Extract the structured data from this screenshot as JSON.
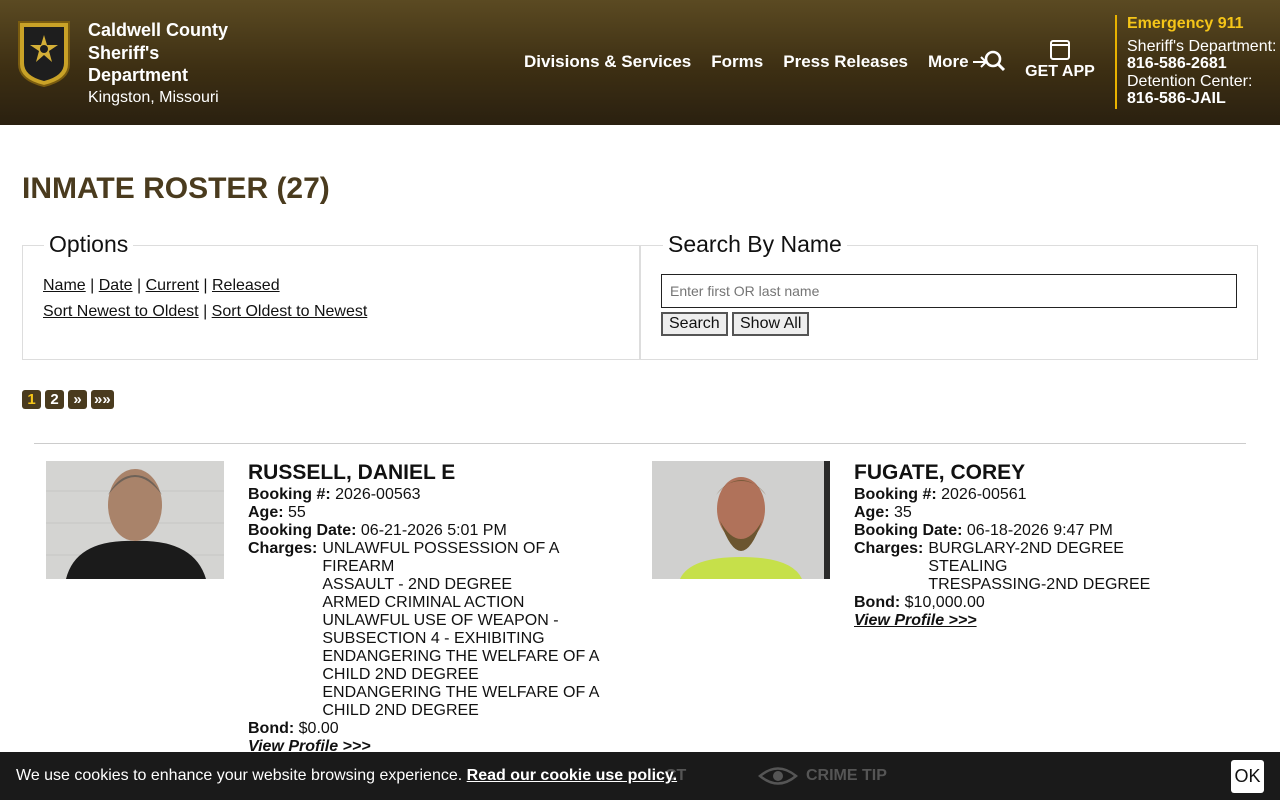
{
  "header": {
    "agency_name": "Caldwell County Sheriff's Department",
    "location": "Kingston, Missouri",
    "nav": [
      {
        "label": "Divisions & Services"
      },
      {
        "label": "Forms"
      },
      {
        "label": "Press Releases"
      },
      {
        "label": "More"
      }
    ],
    "get_app": "GET APP",
    "emergency": "Emergency 911",
    "sheriff_label": "Sheriff's Department:",
    "sheriff_phone": "816-586-2681",
    "detention_label": "Detention Center:",
    "detention_phone": "816-586-JAIL"
  },
  "page": {
    "title": "INMATE ROSTER (27)"
  },
  "options": {
    "legend": "Options",
    "links_row1": [
      "Name",
      "Date",
      "Current",
      "Released"
    ],
    "links_row2": [
      "Sort Newest to Oldest",
      "Sort Oldest to Newest"
    ]
  },
  "search": {
    "legend": "Search By Name",
    "placeholder": "Enter first OR last name",
    "search_button": "Search",
    "show_all_button": "Show All"
  },
  "pager": {
    "pages": [
      "1",
      "2"
    ],
    "next": "»",
    "last": "»»",
    "current": "1"
  },
  "labels": {
    "booking": "Booking #:",
    "age": "Age:",
    "booking_date": "Booking Date:",
    "charges": "Charges:",
    "bond": "Bond:",
    "view_profile": "View Profile >>>"
  },
  "inmates": [
    {
      "name": "RUSSELL, DANIEL E",
      "booking": "2026-00563",
      "age": "55",
      "booking_date": "06-21-2026 5:01 PM",
      "charges": [
        "UNLAWFUL POSSESSION OF A FIREARM",
        "ASSAULT - 2ND DEGREE",
        "ARMED CRIMINAL ACTION",
        "UNLAWFUL USE OF WEAPON - SUBSECTION 4 - EXHIBITING",
        "ENDANGERING THE WELFARE OF A CHILD 2ND DEGREE",
        "ENDANGERING THE WELFARE OF A CHILD 2ND DEGREE"
      ],
      "bond": "$0.00"
    },
    {
      "name": "FUGATE, COREY",
      "booking": "2026-00561",
      "age": "35",
      "booking_date": "06-18-2026 9:47 PM",
      "charges": [
        "BURGLARY-2ND DEGREE",
        "STEALING",
        "TRESPASSING-2ND DEGREE"
      ],
      "bond": "$10,000.00"
    }
  ],
  "cookie": {
    "message": "We use cookies to enhance your website browsing experience.",
    "policy_link": "Read our cookie use policy.",
    "ok": "OK",
    "behind_labels": [
      "CT",
      "CRIME TIP"
    ]
  }
}
